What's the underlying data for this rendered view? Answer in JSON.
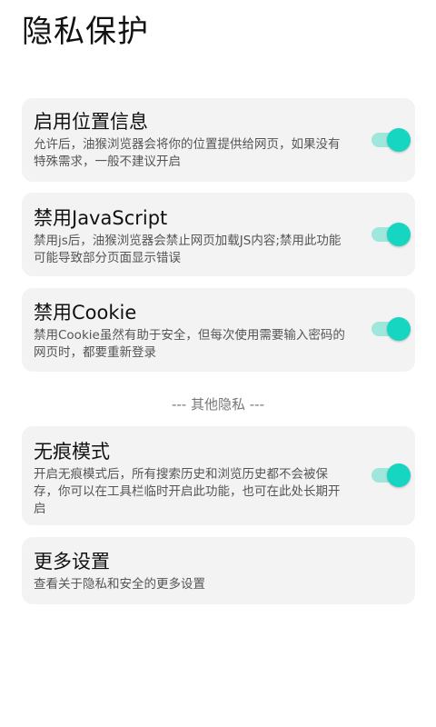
{
  "header": {
    "title": "隐私保护"
  },
  "settings": [
    {
      "title": "启用位置信息",
      "desc": "允许后，油猴浏览器会将你的位置提供给网页，如果没有特殊需求，一般不建议开启",
      "toggle_on": true
    },
    {
      "title": "禁用JavaScript",
      "desc": "禁用js后，油猴浏览器会禁止网页加载JS内容;禁用此功能可能导致部分页面显示错误",
      "toggle_on": true
    },
    {
      "title": "禁用Cookie",
      "desc": "禁用Cookie虽然有助于安全，但每次使用需要输入密码的网页时，都要重新登录",
      "toggle_on": true
    }
  ],
  "divider": {
    "label": "--- 其他隐私 ---"
  },
  "other": [
    {
      "title": "无痕模式",
      "desc": "开启无痕模式后，所有搜索历史和浏览历史都不会被保存，你可以在工具栏临时开启此功能，也可在此处长期开启",
      "toggle_on": true
    },
    {
      "title": "更多设置",
      "desc": "查看关于隐私和安全的更多设置"
    }
  ],
  "colors": {
    "accent": "#16d6c2",
    "track": "#9fe6dc",
    "card_bg": "#f3f3f3"
  }
}
